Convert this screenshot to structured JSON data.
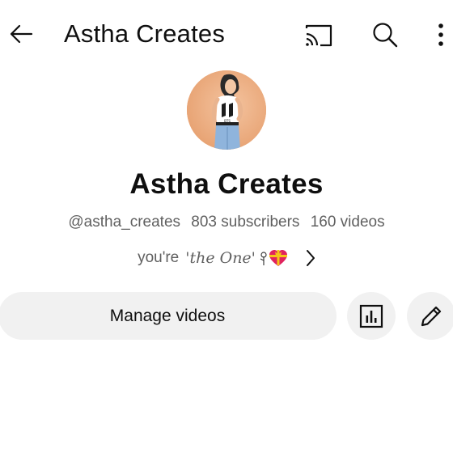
{
  "header": {
    "title": "Astha Creates",
    "icons": [
      "back-arrow-icon",
      "cast-icon",
      "search-icon",
      "more-vertical-icon"
    ]
  },
  "channel": {
    "name": "Astha Creates",
    "handle": "@astha_creates",
    "subscribers": "803 subscribers",
    "videos": "160 videos",
    "description_prefix": "you're",
    "description_quote": "'the One'",
    "avatar_bg": "#e9a778"
  },
  "actions": {
    "manage_videos": "Manage videos",
    "analytics_icon": "analytics-icon",
    "edit_icon": "pencil-icon"
  },
  "colors": {
    "text_primary": "#0f0f0f",
    "text_secondary": "#606060",
    "button_bg": "#f1f1f1"
  }
}
